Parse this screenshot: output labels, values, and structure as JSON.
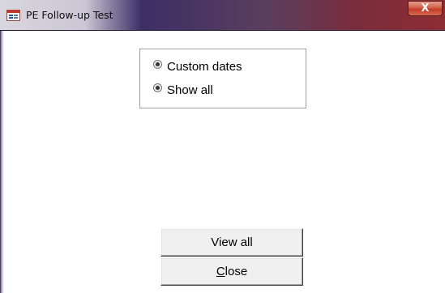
{
  "window": {
    "title": "PE Follow-up Test",
    "close_glyph": "X",
    "icon": "access-form-icon"
  },
  "options": {
    "items": [
      {
        "label": "Custom dates"
      },
      {
        "label": "Show all"
      }
    ]
  },
  "buttons": {
    "view_all_label": "View all",
    "close_accel": "C",
    "close_rest": "lose"
  },
  "colors": {
    "titlebar_start": "#2a1f4c",
    "titlebar_end": "#8e2c33",
    "close_button": "#c43b26",
    "button_face": "#f0f0f0"
  }
}
